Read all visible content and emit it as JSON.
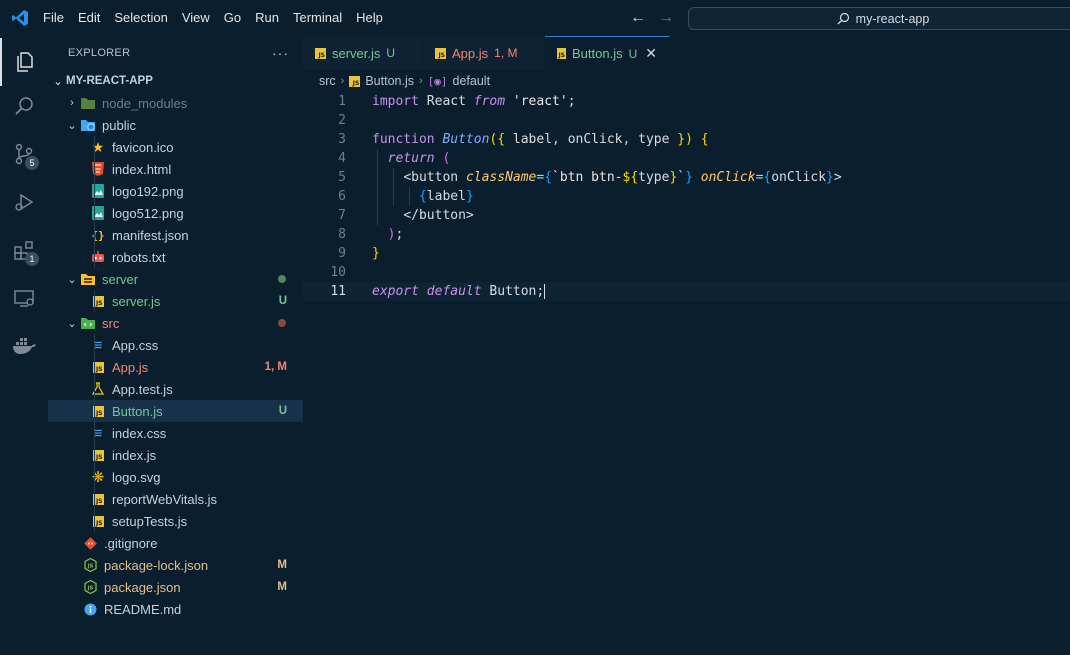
{
  "menu": [
    "File",
    "Edit",
    "Selection",
    "View",
    "Go",
    "Run",
    "Terminal",
    "Help"
  ],
  "command_center": {
    "text": "my-react-app"
  },
  "activity": {
    "scm_badge": "5",
    "extensions_badge": "1"
  },
  "explorer": {
    "title": "EXPLORER",
    "more": "···",
    "project": "MY-REACT-APP"
  },
  "tree": [
    {
      "label": "node_modules",
      "status": ""
    },
    {
      "label": "public",
      "status": ""
    },
    {
      "label": "favicon.ico",
      "status": ""
    },
    {
      "label": "index.html",
      "status": ""
    },
    {
      "label": "logo192.png",
      "status": ""
    },
    {
      "label": "logo512.png",
      "status": ""
    },
    {
      "label": "manifest.json",
      "status": ""
    },
    {
      "label": "robots.txt",
      "status": ""
    },
    {
      "label": "server",
      "status": ""
    },
    {
      "label": "server.js",
      "status": "U"
    },
    {
      "label": "src",
      "status": ""
    },
    {
      "label": "App.css",
      "status": ""
    },
    {
      "label": "App.js",
      "status": "1, M"
    },
    {
      "label": "App.test.js",
      "status": ""
    },
    {
      "label": "Button.js",
      "status": "U"
    },
    {
      "label": "index.css",
      "status": ""
    },
    {
      "label": "index.js",
      "status": ""
    },
    {
      "label": "logo.svg",
      "status": ""
    },
    {
      "label": "reportWebVitals.js",
      "status": ""
    },
    {
      "label": "setupTests.js",
      "status": ""
    },
    {
      "label": ".gitignore",
      "status": ""
    },
    {
      "label": "package-lock.json",
      "status": "M"
    },
    {
      "label": "package.json",
      "status": "M"
    },
    {
      "label": "README.md",
      "status": ""
    }
  ],
  "tabs": [
    {
      "label": "server.js",
      "status": "U"
    },
    {
      "label": "App.js",
      "status": "1, M"
    },
    {
      "label": "Button.js",
      "status": "U",
      "close": "✕"
    }
  ],
  "breadcrumb": {
    "folder": "src",
    "file": "Button.js",
    "symbol": "default"
  },
  "line_numbers": [
    "1",
    "2",
    "3",
    "4",
    "5",
    "6",
    "7",
    "8",
    "9",
    "10",
    "11"
  ],
  "code": {
    "l1": {
      "kw": "import",
      "id": " React ",
      "from": "from",
      "str": " 'react'",
      "semi": ";"
    },
    "l3": {
      "kw": "function",
      "name": "Button",
      "open": "({",
      "p1": " label",
      "c1": ",",
      "p2": " onClick",
      "c2": ",",
      "p3": " type",
      "close": " })",
      "brace": " {"
    },
    "l4": {
      "kw": "return",
      "paren": " ("
    },
    "l5": {
      "lt": "<",
      "tag": "button",
      "attr1": "className",
      "eq1": "=",
      "b1": "{",
      "tpl1": "`btn btn-",
      "dollar": "${",
      "var": "type",
      "dclose": "}",
      "tpl2": "`",
      "b2": "}",
      "attr2": "onClick",
      "eq2": "=",
      "b3": "{",
      "handler": "onClick",
      "b4": "}",
      "gt": ">"
    },
    "l6": {
      "b1": "{",
      "var": "label",
      "b2": "}"
    },
    "l7": {
      "text": "</button>"
    },
    "l8": {
      "paren": ")",
      "semi": ";"
    },
    "l9": {
      "brace": "}"
    },
    "l11": {
      "kw1": "export",
      "kw2": " default",
      "name": " Button",
      "semi": ";"
    }
  },
  "colors": {
    "background": "#0b1e2e",
    "modified": "#e2c08d",
    "untracked": "#73c991",
    "error": "#f48771",
    "js_icon": "#e8c33b"
  }
}
